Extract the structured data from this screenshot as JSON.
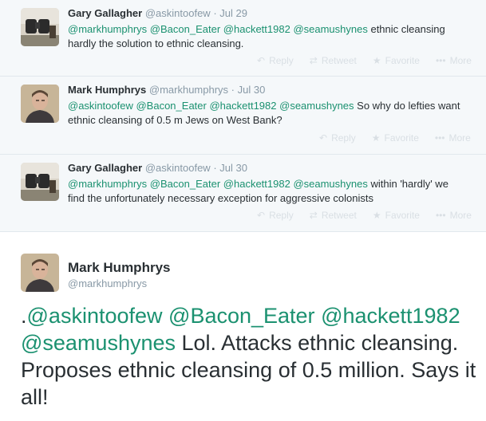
{
  "replies": [
    {
      "name": "Gary Gallagher",
      "handle": "@askintoofew",
      "sep": "·",
      "date": "Jul 29",
      "mentions": [
        "@markhumphrys",
        "@Bacon_Eater",
        "@hackett1982",
        "@seamushynes"
      ],
      "text": "ethnic cleansing hardly the solution to ethnic cleansing.",
      "avatar": "binoculars-avatar"
    },
    {
      "name": "Mark Humphrys",
      "handle": "@markhumphrys",
      "sep": "·",
      "date": "Jul 30",
      "mentions": [
        "@askintoofew",
        "@Bacon_Eater",
        "@hackett1982",
        "@seamushynes"
      ],
      "text": "So why do lefties want ethnic cleansing of 0.5 m Jews on West Bank?",
      "avatar": "portrait-avatar"
    },
    {
      "name": "Gary Gallagher",
      "handle": "@askintoofew",
      "sep": "·",
      "date": "Jul 30",
      "mentions": [
        "@markhumphrys",
        "@Bacon_Eater",
        "@hackett1982",
        "@seamushynes"
      ],
      "text": "within 'hardly' we find the unfortunately necessary exception for aggressive colonists",
      "avatar": "binoculars-avatar"
    }
  ],
  "actions": {
    "reply": "Reply",
    "retweet": "Retweet",
    "favorite": "Favorite",
    "more": "More",
    "reply_icon": "reply-icon",
    "retweet_icon": "retweet-icon",
    "favorite_icon": "star-icon",
    "more_icon": "ellipsis-icon"
  },
  "main": {
    "name": "Mark Humphrys",
    "handle": "@markhumphrys",
    "prefix": ".",
    "mentions": [
      "@askintoofew",
      "@Bacon_Eater",
      "@hackett1982",
      "@seamushynes"
    ],
    "text": "Lol. Attacks ethnic cleansing. Proposes ethnic cleansing of 0.5 million. Says it all!",
    "avatar": "portrait-avatar"
  },
  "colors": {
    "mention": "#1b9170",
    "reply_bg": "#f5f8fa",
    "action": "#d9dfe4",
    "meta": "#8899a6"
  }
}
